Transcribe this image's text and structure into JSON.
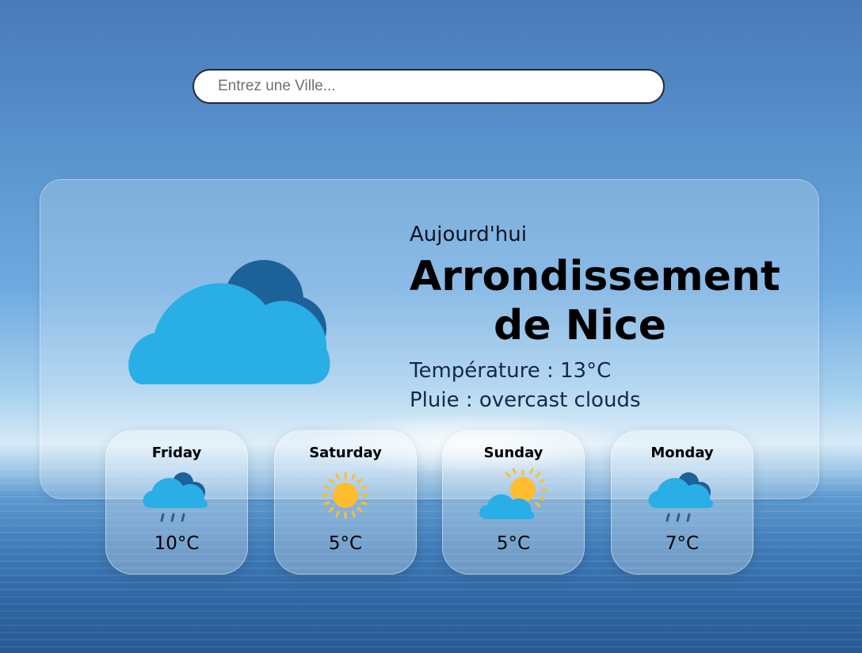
{
  "search": {
    "placeholder": "Entrez une Ville..."
  },
  "current": {
    "label": "Aujourd'hui",
    "city": "Arrondissement de Nice",
    "temperature_line": "Température : 13°C",
    "rain_line": "Pluie : overcast clouds",
    "icon": "cloud-icon"
  },
  "forecast": [
    {
      "day": "Friday",
      "temp": "10°C",
      "icon": "rain-cloud-icon"
    },
    {
      "day": "Saturday",
      "temp": "5°C",
      "icon": "sun-icon"
    },
    {
      "day": "Sunday",
      "temp": "5°C",
      "icon": "partly-cloudy-icon"
    },
    {
      "day": "Monday",
      "temp": "7°C",
      "icon": "rain-cloud-icon"
    }
  ],
  "colors": {
    "cloud_light": "#2aaee6",
    "cloud_dark": "#1c6197",
    "sun": "#fdbd2f",
    "rain": "#2c5d93"
  }
}
